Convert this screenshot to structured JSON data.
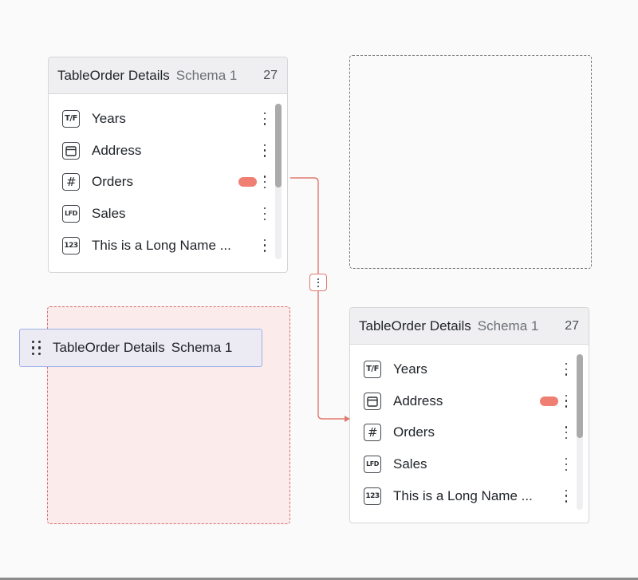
{
  "colors": {
    "accent_red": "#ef7f72",
    "connector": "#e07a70",
    "drag_border": "#9fb1ea",
    "drop_fill": "#fbeceb"
  },
  "tables": [
    {
      "title": "TableOrder Details",
      "schema": "Schema 1",
      "count": "27",
      "fields": [
        {
          "icon_text": "T/F",
          "icon": "boolean-icon",
          "label": "Years",
          "badge": false
        },
        {
          "icon_text": "",
          "icon": "calendar-icon",
          "label": "Address",
          "badge": false
        },
        {
          "icon_text": "#",
          "icon": "number-icon",
          "label": "Orders",
          "badge": true
        },
        {
          "icon_text": "LFD",
          "icon": "decimal-icon",
          "label": "Sales",
          "badge": false
        },
        {
          "icon_text": "123",
          "icon": "integer-icon",
          "label": "This is a Long Name ...",
          "badge": false
        }
      ]
    },
    {
      "title": "TableOrder Details",
      "schema": "Schema 1",
      "count": "27",
      "fields": [
        {
          "icon_text": "T/F",
          "icon": "boolean-icon",
          "label": "Years",
          "badge": false
        },
        {
          "icon_text": "",
          "icon": "calendar-icon",
          "label": "Address",
          "badge": true
        },
        {
          "icon_text": "#",
          "icon": "number-icon",
          "label": "Orders",
          "badge": false
        },
        {
          "icon_text": "LFD",
          "icon": "decimal-icon",
          "label": "Sales",
          "badge": false
        },
        {
          "icon_text": "123",
          "icon": "integer-icon",
          "label": "This is a Long Name ...",
          "badge": false
        }
      ]
    }
  ],
  "drag_ghost": {
    "title": "TableOrder Details",
    "schema": "Schema 1",
    "icon": "drag-handle-icon"
  },
  "connector": {
    "from": "Orders",
    "to": "Address",
    "icon": "kebab-menu-icon"
  }
}
